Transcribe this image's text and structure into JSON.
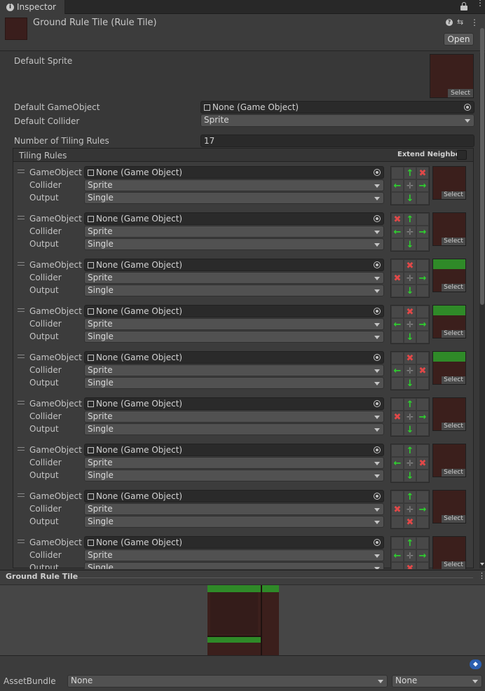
{
  "tab": {
    "label": "Inspector"
  },
  "header": {
    "title": "Ground Rule Tile (Rule Tile)",
    "open_label": "Open"
  },
  "fields": {
    "default_sprite_label": "Default Sprite",
    "select_label": "Select",
    "default_gameobject_label": "Default GameObject",
    "default_gameobject_value": "None (Game Object)",
    "default_collider_label": "Default Collider",
    "default_collider_value": "Sprite",
    "num_rules_label": "Number of Tiling Rules",
    "num_rules_value": "17"
  },
  "rules_header": {
    "title": "Tiling Rules",
    "extend_neighbor": "Extend Neighbor"
  },
  "rule_labels": {
    "gameobject": "GameObject",
    "collider": "Collider",
    "output": "Output"
  },
  "rules": [
    {
      "gameobject": "None (Game Object)",
      "collider": "Sprite",
      "output": "Single"
    },
    {
      "gameobject": "None (Game Object)",
      "collider": "Sprite",
      "output": "Single"
    },
    {
      "gameobject": "None (Game Object)",
      "collider": "Sprite",
      "output": "Single"
    },
    {
      "gameobject": "None (Game Object)",
      "collider": "Sprite",
      "output": "Single"
    },
    {
      "gameobject": "None (Game Object)",
      "collider": "Sprite",
      "output": "Single"
    },
    {
      "gameobject": "None (Game Object)",
      "collider": "Sprite",
      "output": "Single"
    },
    {
      "gameobject": "None (Game Object)",
      "collider": "Sprite",
      "output": "Single"
    },
    {
      "gameobject": "None (Game Object)",
      "collider": "Sprite",
      "output": "Single"
    },
    {
      "gameobject": "None (Game Object)",
      "collider": "Sprite",
      "output": "Single"
    }
  ],
  "preview": {
    "title": "Ground Rule Tile"
  },
  "assetbundle": {
    "label": "AssetBundle",
    "value": "None",
    "variant": "None"
  }
}
